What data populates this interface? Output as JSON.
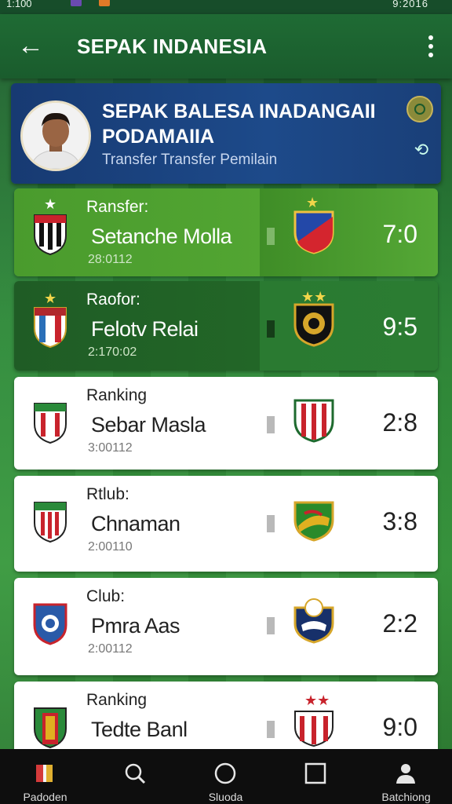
{
  "status_bar": {
    "time": "1:100",
    "right": "9:2016"
  },
  "app_bar": {
    "title": "SEPAK INDANESIA"
  },
  "profile": {
    "title_line1": "SEPAK BALESA INADANGAII",
    "title_line2": "PODAMAIIA",
    "subtitle": "Transfer Transfer Pemilain"
  },
  "matches": [
    {
      "category": "Ransfer:",
      "name": "Setanche Molla",
      "date": "28:0112",
      "score": "7:0",
      "style": "green"
    },
    {
      "category": "Raofor:",
      "name": "Felotv Relai",
      "date": "2:170:02",
      "score": "9:5",
      "style": "dark"
    },
    {
      "category": "Ranking",
      "name": "Sebar Masla",
      "date": "3:00112",
      "score": "2:8",
      "style": "white"
    },
    {
      "category": "Rtlub:",
      "name": "Chnaman",
      "date": "2:00110",
      "score": "3:8",
      "style": "white"
    },
    {
      "category": "Club:",
      "name": "Pmra Aas",
      "date": "2:00112",
      "score": "2:2",
      "style": "white"
    },
    {
      "category": "Ranking",
      "name": "Tedte Banl",
      "date": "",
      "score": "9:0",
      "style": "white"
    }
  ],
  "nav": [
    {
      "label": "Padoden",
      "icon": "book-icon"
    },
    {
      "label": "",
      "icon": "search-icon"
    },
    {
      "label": "Sluoda",
      "icon": "circle-icon"
    },
    {
      "label": "",
      "icon": "square-icon"
    },
    {
      "label": "Batchiong",
      "icon": "person-icon"
    }
  ]
}
